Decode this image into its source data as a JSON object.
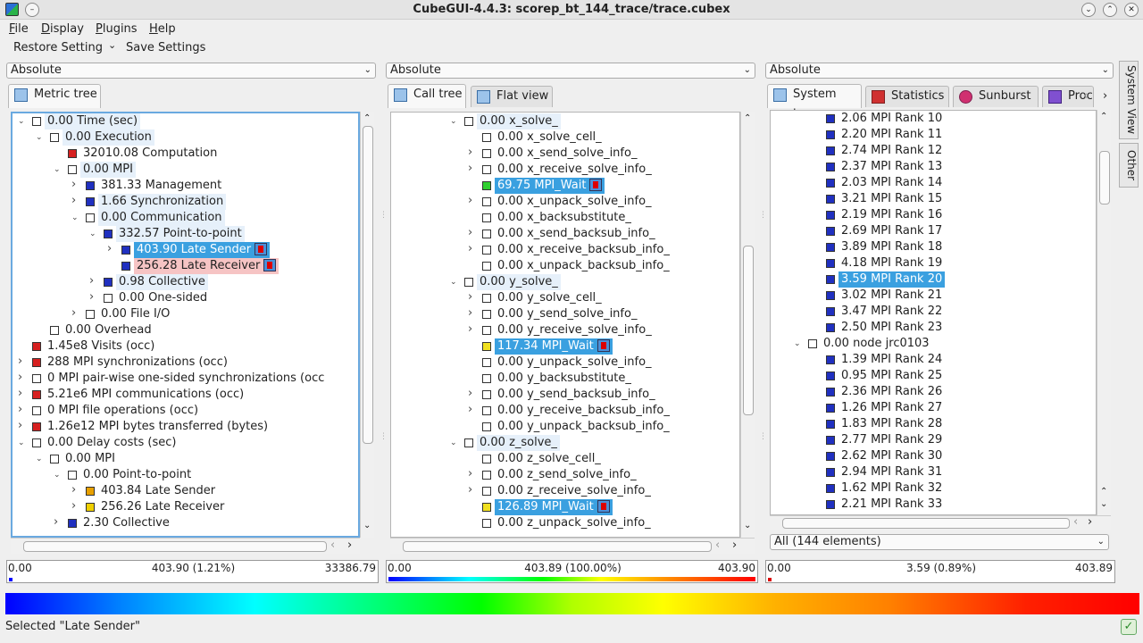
{
  "window": {
    "title": "CubeGUI-4.4.3: scorep_bt_144_trace/trace.cubex"
  },
  "menu": [
    "File",
    "Display",
    "Plugins",
    "Help"
  ],
  "toolbar": {
    "restore": "Restore Setting",
    "save": "Save Settings"
  },
  "panels": {
    "metric": {
      "mode": "Absolute",
      "tab": "Metric tree",
      "status": {
        "min": "0.00",
        "mid": "403.90 (1.21%)",
        "max": "33386.79"
      }
    },
    "call": {
      "mode": "Absolute",
      "tabs": [
        "Call tree",
        "Flat view"
      ],
      "status": {
        "min": "0.00",
        "mid": "403.89 (100.00%)",
        "max": "403.90"
      }
    },
    "system": {
      "mode": "Absolute",
      "tabs": [
        "System tree",
        "Statistics",
        "Sunburst",
        "Proc"
      ],
      "filter": "All (144 elements)",
      "status": {
        "min": "0.00",
        "mid": "3.59 (0.89%)",
        "max": "403.89"
      }
    }
  },
  "metric_rows": [
    {
      "d": 0,
      "e": "v",
      "box": "empty",
      "t": "0.00 Time (sec)",
      "h": "lb"
    },
    {
      "d": 1,
      "e": "v",
      "box": "empty",
      "t": "0.00 Execution",
      "h": "lb"
    },
    {
      "d": 2,
      "e": "",
      "box": "#d62020",
      "t": "32010.08 Computation",
      "h": ""
    },
    {
      "d": 2,
      "e": "v",
      "box": "empty",
      "t": "0.00 MPI",
      "h": "lb"
    },
    {
      "d": 3,
      "e": ">",
      "box": "#2030c0",
      "t": "381.33 Management",
      "h": ""
    },
    {
      "d": 3,
      "e": ">",
      "box": "#2030c0",
      "t": "1.66 Synchronization",
      "h": "lb"
    },
    {
      "d": 3,
      "e": "v",
      "box": "empty",
      "t": "0.00 Communication",
      "h": "lb"
    },
    {
      "d": 4,
      "e": "v",
      "box": "#2030c0",
      "t": "332.57 Point-to-point",
      "h": "lb"
    },
    {
      "d": 5,
      "e": ">",
      "box": "#2030c0",
      "t": "403.90 Late Sender",
      "h": "sel",
      "m": true
    },
    {
      "d": 5,
      "e": "",
      "box": "#2030c0",
      "t": "256.28 Late Receiver",
      "h": "pink",
      "m": true
    },
    {
      "d": 4,
      "e": ">",
      "box": "#2030c0",
      "t": "0.98 Collective",
      "h": "lb"
    },
    {
      "d": 4,
      "e": ">",
      "box": "empty",
      "t": "0.00 One-sided",
      "h": ""
    },
    {
      "d": 3,
      "e": ">",
      "box": "empty",
      "t": "0.00 File I/O",
      "h": ""
    },
    {
      "d": 1,
      "e": "",
      "box": "empty",
      "t": "0.00 Overhead",
      "h": ""
    },
    {
      "d": 0,
      "e": "",
      "box": "#d62020",
      "t": "1.45e8 Visits (occ)",
      "h": ""
    },
    {
      "d": 0,
      "e": ">",
      "box": "#d62020",
      "t": "288 MPI synchronizations (occ)",
      "h": ""
    },
    {
      "d": 0,
      "e": ">",
      "box": "empty",
      "t": "0 MPI pair-wise one-sided synchronizations (occ",
      "h": ""
    },
    {
      "d": 0,
      "e": ">",
      "box": "#d62020",
      "t": "5.21e6 MPI communications (occ)",
      "h": ""
    },
    {
      "d": 0,
      "e": ">",
      "box": "empty",
      "t": "0 MPI file operations (occ)",
      "h": ""
    },
    {
      "d": 0,
      "e": ">",
      "box": "#d62020",
      "t": "1.26e12 MPI bytes transferred (bytes)",
      "h": ""
    },
    {
      "d": 0,
      "e": "v",
      "box": "empty",
      "t": "0.00 Delay costs (sec)",
      "h": ""
    },
    {
      "d": 1,
      "e": "v",
      "box": "empty",
      "t": "0.00 MPI",
      "h": ""
    },
    {
      "d": 2,
      "e": "v",
      "box": "empty",
      "t": "0.00 Point-to-point",
      "h": ""
    },
    {
      "d": 3,
      "e": ">",
      "box": "#e8a000",
      "t": "403.84 Late Sender",
      "h": ""
    },
    {
      "d": 3,
      "e": ">",
      "box": "#f0d000",
      "t": "256.26 Late Receiver",
      "h": ""
    },
    {
      "d": 2,
      "e": ">",
      "box": "#2030c0",
      "t": "2.30 Collective",
      "h": ""
    }
  ],
  "call_rows": [
    {
      "d": 0,
      "e": "v",
      "box": "empty",
      "t": "0.00 x_solve_",
      "h": "lb"
    },
    {
      "d": 1,
      "e": "",
      "box": "empty",
      "t": "0.00 x_solve_cell_",
      "h": ""
    },
    {
      "d": 1,
      "e": ">",
      "box": "empty",
      "t": "0.00 x_send_solve_info_",
      "h": ""
    },
    {
      "d": 1,
      "e": ">",
      "box": "empty",
      "t": "0.00 x_receive_solve_info_",
      "h": ""
    },
    {
      "d": 1,
      "e": "",
      "box": "#30d030",
      "t": "69.75 MPI_Wait",
      "h": "sel",
      "m": true
    },
    {
      "d": 1,
      "e": ">",
      "box": "empty",
      "t": "0.00 x_unpack_solve_info_",
      "h": ""
    },
    {
      "d": 1,
      "e": "",
      "box": "empty",
      "t": "0.00 x_backsubstitute_",
      "h": ""
    },
    {
      "d": 1,
      "e": ">",
      "box": "empty",
      "t": "0.00 x_send_backsub_info_",
      "h": ""
    },
    {
      "d": 1,
      "e": ">",
      "box": "empty",
      "t": "0.00 x_receive_backsub_info_",
      "h": ""
    },
    {
      "d": 1,
      "e": "",
      "box": "empty",
      "t": "0.00 x_unpack_backsub_info_",
      "h": ""
    },
    {
      "d": 0,
      "e": "v",
      "box": "empty",
      "t": "0.00 y_solve_",
      "h": "lb"
    },
    {
      "d": 1,
      "e": ">",
      "box": "empty",
      "t": "0.00 y_solve_cell_",
      "h": ""
    },
    {
      "d": 1,
      "e": ">",
      "box": "empty",
      "t": "0.00 y_send_solve_info_",
      "h": ""
    },
    {
      "d": 1,
      "e": ">",
      "box": "empty",
      "t": "0.00 y_receive_solve_info_",
      "h": ""
    },
    {
      "d": 1,
      "e": "",
      "box": "#f0e020",
      "t": "117.34 MPI_Wait",
      "h": "sel",
      "m": true
    },
    {
      "d": 1,
      "e": "",
      "box": "empty",
      "t": "0.00 y_unpack_solve_info_",
      "h": ""
    },
    {
      "d": 1,
      "e": "",
      "box": "empty",
      "t": "0.00 y_backsubstitute_",
      "h": ""
    },
    {
      "d": 1,
      "e": ">",
      "box": "empty",
      "t": "0.00 y_send_backsub_info_",
      "h": ""
    },
    {
      "d": 1,
      "e": ">",
      "box": "empty",
      "t": "0.00 y_receive_backsub_info_",
      "h": ""
    },
    {
      "d": 1,
      "e": "",
      "box": "empty",
      "t": "0.00 y_unpack_backsub_info_",
      "h": ""
    },
    {
      "d": 0,
      "e": "v",
      "box": "empty",
      "t": "0.00 z_solve_",
      "h": "lb"
    },
    {
      "d": 1,
      "e": "",
      "box": "empty",
      "t": "0.00 z_solve_cell_",
      "h": ""
    },
    {
      "d": 1,
      "e": ">",
      "box": "empty",
      "t": "0.00 z_send_solve_info_",
      "h": ""
    },
    {
      "d": 1,
      "e": ">",
      "box": "empty",
      "t": "0.00 z_receive_solve_info_",
      "h": ""
    },
    {
      "d": 1,
      "e": "",
      "box": "#f0e020",
      "t": "126.89 MPI_Wait",
      "h": "sel",
      "m": true
    },
    {
      "d": 1,
      "e": "",
      "box": "empty",
      "t": "0.00 z_unpack_solve_info_",
      "h": ""
    }
  ],
  "system_rows": [
    {
      "d": 2,
      "e": "",
      "box": "#2030c0",
      "t": "2.06 MPI Rank 10",
      "h": ""
    },
    {
      "d": 2,
      "e": "",
      "box": "#2030c0",
      "t": "2.20 MPI Rank 11",
      "h": ""
    },
    {
      "d": 2,
      "e": "",
      "box": "#2030c0",
      "t": "2.74 MPI Rank 12",
      "h": ""
    },
    {
      "d": 2,
      "e": "",
      "box": "#2030c0",
      "t": "2.37 MPI Rank 13",
      "h": ""
    },
    {
      "d": 2,
      "e": "",
      "box": "#2030c0",
      "t": "2.03 MPI Rank 14",
      "h": ""
    },
    {
      "d": 2,
      "e": "",
      "box": "#2030c0",
      "t": "3.21 MPI Rank 15",
      "h": ""
    },
    {
      "d": 2,
      "e": "",
      "box": "#2030c0",
      "t": "2.19 MPI Rank 16",
      "h": ""
    },
    {
      "d": 2,
      "e": "",
      "box": "#2030c0",
      "t": "2.69 MPI Rank 17",
      "h": ""
    },
    {
      "d": 2,
      "e": "",
      "box": "#2030c0",
      "t": "3.89 MPI Rank 18",
      "h": ""
    },
    {
      "d": 2,
      "e": "",
      "box": "#2030c0",
      "t": "4.18 MPI Rank 19",
      "h": ""
    },
    {
      "d": 2,
      "e": "",
      "box": "#2030c0",
      "t": "3.59 MPI Rank 20",
      "h": "sel"
    },
    {
      "d": 2,
      "e": "",
      "box": "#2030c0",
      "t": "3.02 MPI Rank 21",
      "h": ""
    },
    {
      "d": 2,
      "e": "",
      "box": "#2030c0",
      "t": "3.47 MPI Rank 22",
      "h": ""
    },
    {
      "d": 2,
      "e": "",
      "box": "#2030c0",
      "t": "2.50 MPI Rank 23",
      "h": ""
    },
    {
      "d": 1,
      "e": "v",
      "box": "empty",
      "t": "0.00 node jrc0103",
      "h": ""
    },
    {
      "d": 2,
      "e": "",
      "box": "#2030c0",
      "t": "1.39 MPI Rank 24",
      "h": ""
    },
    {
      "d": 2,
      "e": "",
      "box": "#2030c0",
      "t": "0.95 MPI Rank 25",
      "h": ""
    },
    {
      "d": 2,
      "e": "",
      "box": "#2030c0",
      "t": "2.36 MPI Rank 26",
      "h": ""
    },
    {
      "d": 2,
      "e": "",
      "box": "#2030c0",
      "t": "1.26 MPI Rank 27",
      "h": ""
    },
    {
      "d": 2,
      "e": "",
      "box": "#2030c0",
      "t": "1.83 MPI Rank 28",
      "h": ""
    },
    {
      "d": 2,
      "e": "",
      "box": "#2030c0",
      "t": "2.77 MPI Rank 29",
      "h": ""
    },
    {
      "d": 2,
      "e": "",
      "box": "#2030c0",
      "t": "2.62 MPI Rank 30",
      "h": ""
    },
    {
      "d": 2,
      "e": "",
      "box": "#2030c0",
      "t": "2.94 MPI Rank 31",
      "h": ""
    },
    {
      "d": 2,
      "e": "",
      "box": "#2030c0",
      "t": "1.62 MPI Rank 32",
      "h": ""
    },
    {
      "d": 2,
      "e": "",
      "box": "#2030c0",
      "t": "2.21 MPI Rank 33",
      "h": ""
    }
  ],
  "sidetabs": [
    "System View",
    "Other"
  ],
  "status": {
    "text": "Selected \"Late Sender\""
  }
}
